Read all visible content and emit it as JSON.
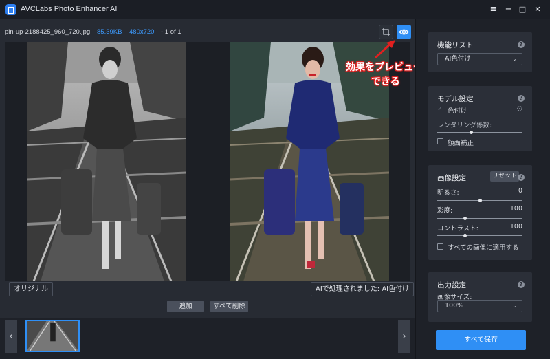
{
  "app": {
    "title": "AVCLabs Photo Enhancer AI"
  },
  "window": {
    "menu_glyph": "≡",
    "minimize_glyph": "−",
    "maximize_glyph": "□",
    "close_glyph": "✕"
  },
  "file": {
    "name": "pin-up-2188425_960_720.jpg",
    "size": "85.39KB",
    "dimensions": "480x720",
    "page": "- 1 of 1"
  },
  "viewer": {
    "original_label": "オリジナル",
    "processed_label": "AIで処理されました: AI色付け"
  },
  "annotation": {
    "line1": "効果をプレビュー",
    "line2": "できる"
  },
  "actions": {
    "add_label": "追加",
    "delete_all_label": "すべて削除",
    "prev_glyph": "‹",
    "next_glyph": "›"
  },
  "panel": {
    "function_list": {
      "title": "機能リスト",
      "selected": "AI色付け"
    },
    "model_settings": {
      "title": "モデル設定",
      "colorize_label": "色付け",
      "rendering_label": "レンダリング係数:",
      "rendering_level": 0.4,
      "face_correction_label": "顔面補正"
    },
    "image_settings": {
      "title": "画像設定",
      "reset_label": "リセット",
      "brightness_label": "明るさ:",
      "brightness_value": "0",
      "brightness_level": 0.5,
      "saturation_label": "彩度:",
      "saturation_value": "100",
      "saturation_level": 0.33,
      "contrast_label": "コントラスト:",
      "contrast_value": "100",
      "contrast_level": 0.33,
      "apply_all_label": "すべての画像に適用する"
    },
    "output_settings": {
      "title": "出力設定",
      "image_size_label": "画像サイズ:",
      "image_size_value": "100%"
    },
    "help_glyph": "?",
    "chevron_glyph": "⌄",
    "check_glyph": "✓",
    "save_all_label": "すべて保存"
  },
  "colors": {
    "accent": "#2f8ff5",
    "annotation_red": "#e02020"
  }
}
